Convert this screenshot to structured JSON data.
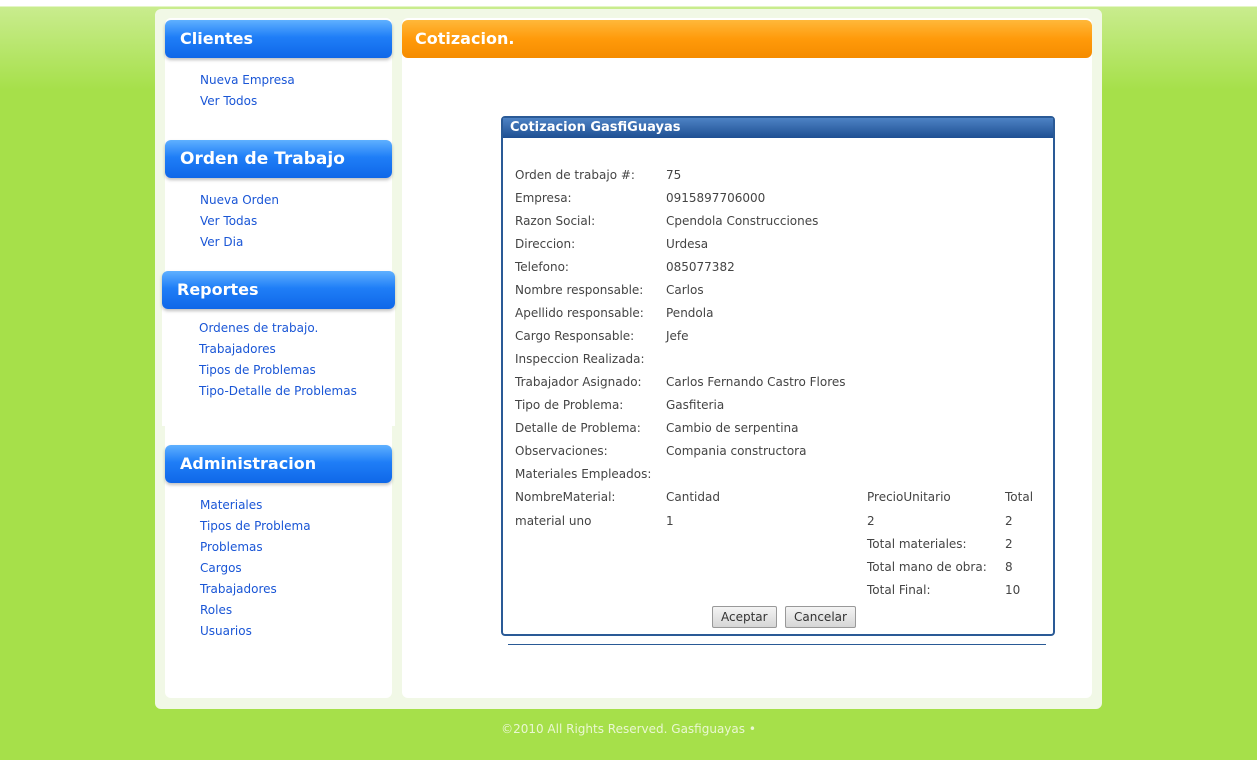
{
  "sidebar": {
    "clientes": {
      "title": "Clientes",
      "links": [
        "Nueva Empresa",
        "Ver Todos"
      ]
    },
    "orden": {
      "title": "Orden de Trabajo",
      "links": [
        "Nueva Orden",
        "Ver Todas",
        "Ver Dia"
      ]
    },
    "reportes": {
      "title": "Reportes",
      "links": [
        "Ordenes de trabajo.",
        "Trabajadores",
        "Tipos de Problemas",
        "Tipo-Detalle de Problemas"
      ]
    },
    "admin": {
      "title": "Administracion",
      "links": [
        "Materiales",
        "Tipos de Problema",
        "Problemas",
        "Cargos",
        "Trabajadores",
        "Roles",
        "Usuarios"
      ]
    }
  },
  "main": {
    "title": "Cotizacion."
  },
  "dialog": {
    "title": "Cotizacion GasfiGuayas",
    "fields": [
      {
        "label": "Orden de trabajo #:",
        "value": "75"
      },
      {
        "label": "Empresa:",
        "value": "0915897706000"
      },
      {
        "label": "Razon Social:",
        "value": "Cpendola Construcciones"
      },
      {
        "label": "Direccion:",
        "value": "Urdesa"
      },
      {
        "label": "Telefono:",
        "value": "085077382"
      },
      {
        "label": "Nombre responsable:",
        "value": "Carlos"
      },
      {
        "label": "Apellido responsable:",
        "value": "Pendola"
      },
      {
        "label": "Cargo Responsable:",
        "value": "Jefe"
      },
      {
        "label": "Inspeccion Realizada:",
        "value": ""
      },
      {
        "label": "Trabajador Asignado:",
        "value": "Carlos Fernando Castro Flores"
      },
      {
        "label": "Tipo de Problema:",
        "value": "Gasfiteria"
      },
      {
        "label": "Detalle de Problema:",
        "value": "Cambio de serpentina"
      },
      {
        "label": "Observaciones:",
        "value": "Compania constructora"
      },
      {
        "label": "Materiales Empleados:",
        "value": ""
      }
    ],
    "materials": {
      "headers": [
        "NombreMaterial:",
        "Cantidad",
        "PrecioUnitario",
        "Total"
      ],
      "rows": [
        [
          "material uno",
          "1",
          "2",
          "2"
        ]
      ],
      "summary": [
        {
          "label": "Total materiales:",
          "value": "2"
        },
        {
          "label": "Total mano de obra:",
          "value": "8"
        },
        {
          "label": "Total Final:",
          "value": "10"
        }
      ]
    },
    "buttons": {
      "accept": "Aceptar",
      "cancel": "Cancelar"
    }
  },
  "footer": {
    "text": "©2010 All Rights Reserved. Gasfiguayas •"
  }
}
